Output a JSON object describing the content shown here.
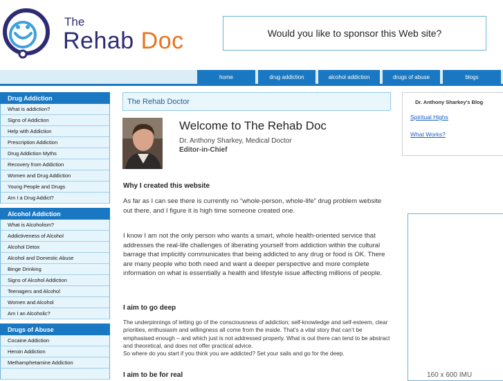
{
  "header": {
    "logo_the": "The",
    "logo_rehab": "Rehab",
    "logo_doc": "Doc",
    "sponsor_text": "Would you like to sponsor this Web site?"
  },
  "nav": {
    "tabs": [
      "home",
      "drug addiction",
      "alcohol addiction",
      "drugs of abuse",
      "blogs"
    ]
  },
  "sidebar": {
    "sections": [
      {
        "title": "Drug Addiction",
        "items": [
          "What is addiction?",
          "Signs of Addiction",
          "Help with Addiction",
          "Prescription Addiction",
          "Drug Addiction Myths",
          "Recovery from Addiction",
          "Women and Drug Addiction",
          "Young People and Drugs",
          "Am I a Drug Addict?"
        ]
      },
      {
        "title": "Alcohol Addiction",
        "items": [
          "What is Alcoholism?",
          "Addictiveness of Alcohol",
          "Alcohol Detox",
          "Alcohol and Domestic Abuse",
          "Binge Drinking",
          "Signs of Alcohol Addiction",
          "Teenagers and Alcohol",
          "Women and Alcohol",
          "Am I an Alcoholic?"
        ]
      },
      {
        "title": "Drugs of Abuse",
        "items": [
          "Cocaine Addiction",
          "Heroin Addiction",
          "Methamphetamine Addiction"
        ]
      }
    ]
  },
  "main": {
    "title": "The Rehab Doctor",
    "welcome": "Welcome to The Rehab Doc",
    "author": "Dr. Anthony Sharkey, Medical Doctor",
    "role": "Editor-in-Chief",
    "section1_heading": "Why I created this website",
    "section1_p1": "As far as I can see there is currently no “whole-person, whole-life” drug problem website out there, and I figure it is high time someone created one.",
    "section1_p2": "I know I am not the only person who wants a smart, whole health-oriented service that addresses the real-life challenges of liberating yourself from addiction within the cultural barrage that implicitly communicates that being addicted to any drug or food is OK. There are many people who both need and want a deeper perspective and more complete information on what is essentially a health and lifestyle issue affecting millions of people.",
    "section2_heading": "I aim to go deep",
    "section2_p1": "The underpinnings of letting go of the consciousness of addiction; self-knowledge and self-esteem, clear priorities, enthusiasm and willingness all come from the inside. That’s a vital story that can’t be emphasised enough – and which just is not addressed properly. What is out there can tend to be abstract and theoretical, and does not offer practical advice.",
    "section2_p2": "So where do you start if you think you are addicted? Set your sails and go for the deep.",
    "section3_heading": "I aim to be for real"
  },
  "right": {
    "blog_title": "Dr. Anthony Sharkey's Blog",
    "links": [
      "Spiritual Highs",
      "What Works?"
    ],
    "ad_text": "160 x 600 IMU"
  },
  "colors": {
    "accent": "#1a78c2",
    "light_blue": "#e6f4fb",
    "brand_navy": "#2d2b72",
    "brand_orange": "#e8731e"
  }
}
